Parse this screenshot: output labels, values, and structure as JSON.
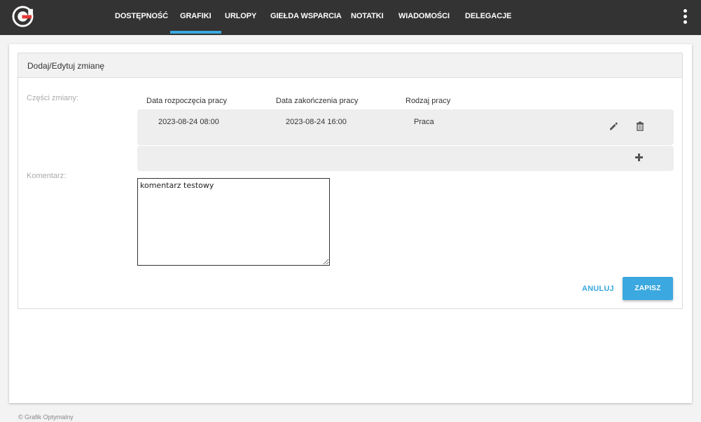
{
  "nav": {
    "items": [
      {
        "label": "DOSTĘPNOŚĆ"
      },
      {
        "label": "GRAFIKI"
      },
      {
        "label": "URLOPY"
      },
      {
        "label": "GIEŁDA WSPARCIA"
      },
      {
        "label": "NOTATKI"
      },
      {
        "label": "WIADOMOŚCI"
      },
      {
        "label": "DELEGACJE"
      }
    ],
    "active": "GRAFIKI"
  },
  "colors": {
    "topbar": "#333333",
    "accent": "#3ba8df",
    "logo_red": "#e53935"
  },
  "panel": {
    "title": "Dodaj/Edytuj zmianę",
    "parts_label": "Części zmiany:",
    "columns": [
      "Data rozpoczęcia pracy",
      "Data zakończenia pracy",
      "Rodzaj pracy"
    ],
    "rows": [
      {
        "start": "2023-08-24 08:00",
        "end": "2023-08-24 16:00",
        "type": "Praca"
      }
    ],
    "comment_label": "Komentarz:",
    "comment_value": "komentarz testowy",
    "cancel_label": "ANULUJ",
    "save_label": "ZAPISZ"
  },
  "icons": [
    "logo-icon",
    "kebab-menu-icon",
    "pencil-icon",
    "trash-icon",
    "plus-icon"
  ],
  "footer": {
    "text": "© Grafik Optymalny"
  }
}
